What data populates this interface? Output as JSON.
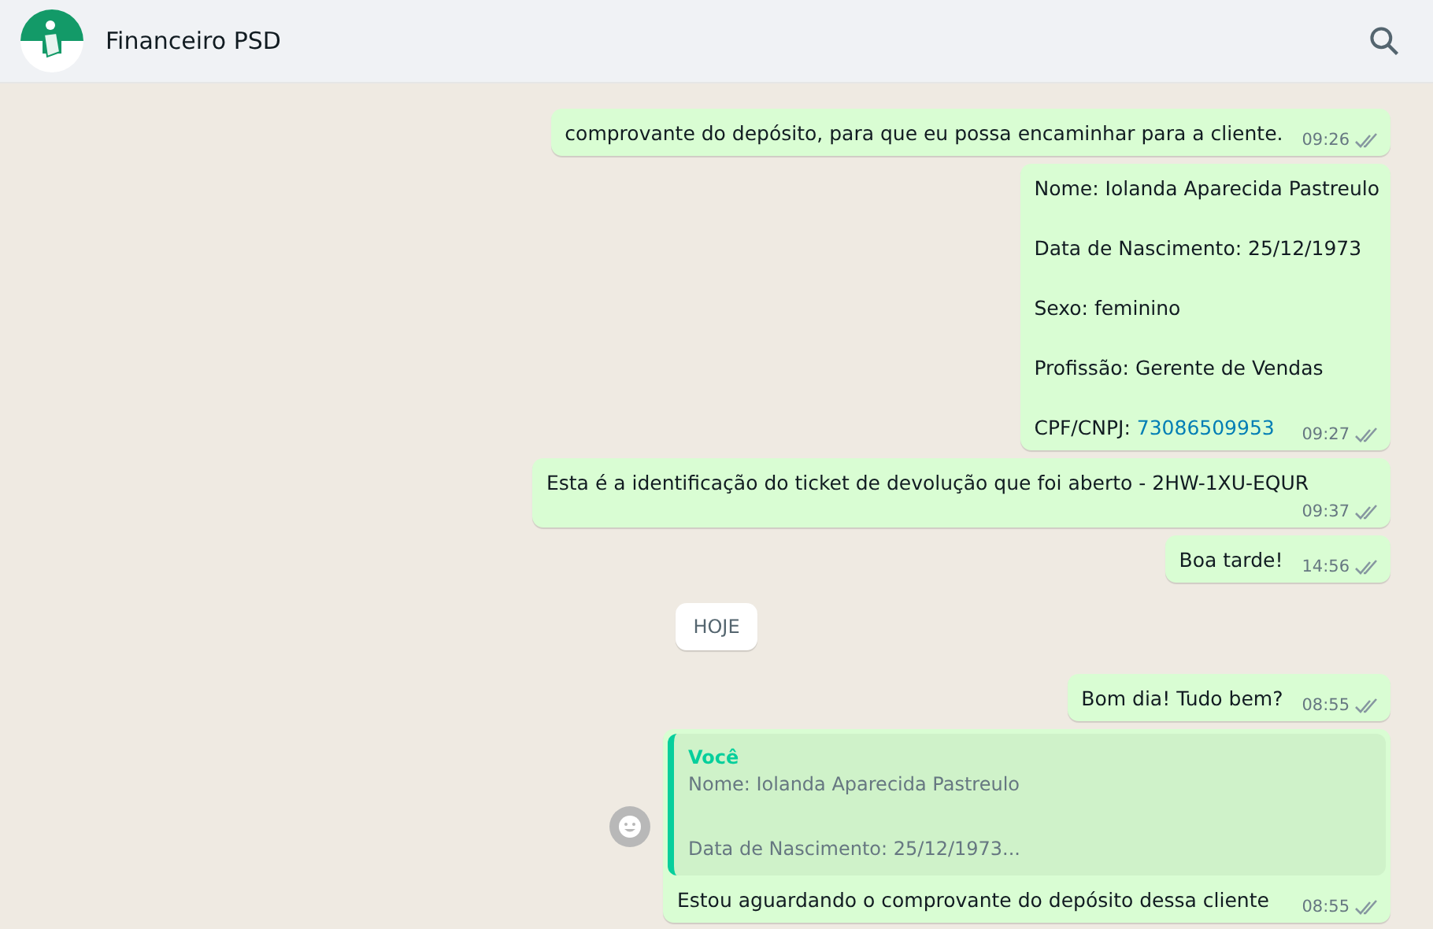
{
  "header": {
    "title": "Financeiro PSD"
  },
  "messages": [
    {
      "kind": "text",
      "lines": [
        {
          "text": "comprovante do depósito, para que eu possa encaminhar para a cliente."
        }
      ],
      "time": "09:26"
    },
    {
      "kind": "text",
      "lines": [
        {
          "text": "Nome: Iolanda Aparecida Pastreulo"
        },
        {
          "text": "Data de Nascimento: 25/12/1973"
        },
        {
          "text": "Sexo: feminino"
        },
        {
          "text": "Profissão: Gerente de Vendas"
        },
        {
          "text": "CPF/CNPJ:",
          "link": "73086509953"
        }
      ],
      "time": "09:27"
    },
    {
      "kind": "text",
      "lines": [
        {
          "text": "Esta é a identificação do ticket de devolução que foi aberto - 2HW-1XU-EQUR"
        }
      ],
      "time": "09:37"
    },
    {
      "kind": "text",
      "lines": [
        {
          "text": "Boa tarde!"
        }
      ],
      "time": "14:56"
    },
    {
      "kind": "date",
      "label": "HOJE"
    },
    {
      "kind": "text",
      "lines": [
        {
          "text": "Bom dia! Tudo bem?"
        }
      ],
      "time": "08:55"
    },
    {
      "kind": "reply",
      "author": "Você",
      "quote": [
        "Nome: Iolanda Aparecida Pastreulo",
        "Data de Nascimento: 25/12/1973..."
      ],
      "lines": [
        {
          "text": "Estou aguardando o comprovante do depósito dessa cliente"
        }
      ],
      "time": "08:55"
    }
  ]
}
